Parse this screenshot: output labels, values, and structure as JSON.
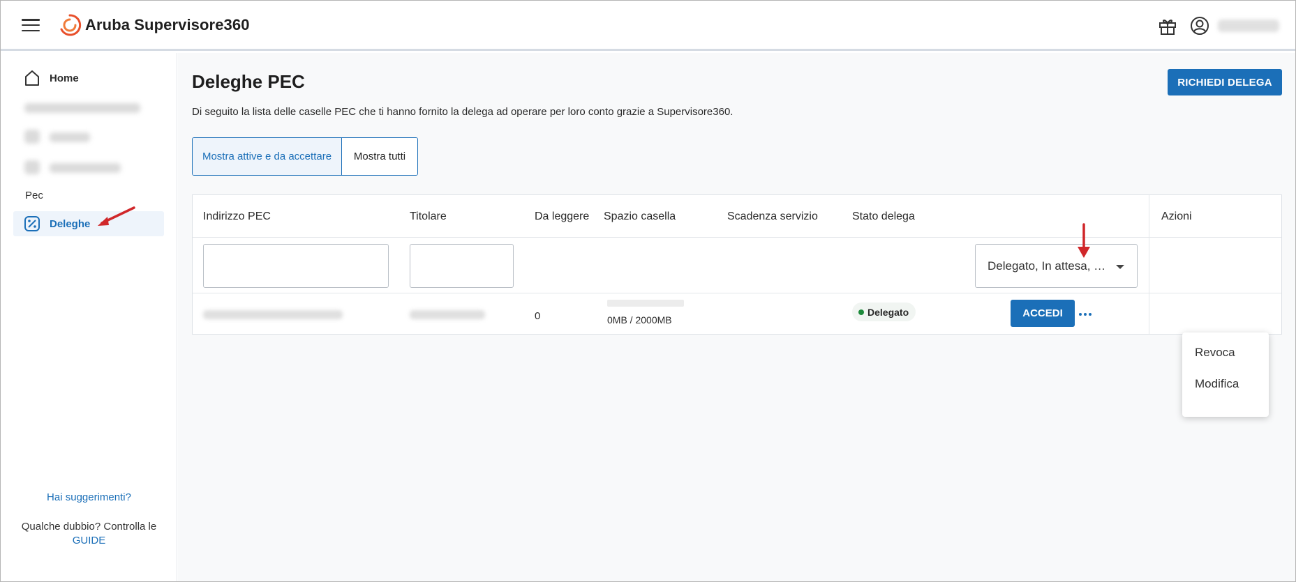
{
  "app": {
    "title": "Aruba Supervisore360"
  },
  "sidebar": {
    "items": [
      {
        "label": "Home",
        "icon": "home-icon"
      },
      {
        "label": "Deleghe",
        "icon": "deleghe-icon",
        "active": true
      }
    ],
    "section_label": "Pec",
    "help_link": "Hai suggerimenti?",
    "help_text_prefix": "Qualche dubbio? Controlla le",
    "help_guide_link": "GUIDE"
  },
  "main": {
    "title": "Deleghe PEC",
    "description": "Di seguito la lista delle caselle PEC che ti hanno fornito la delega ad operare per loro conto grazie a Supervisore360.",
    "primary_button": "RICHIEDI DELEGA",
    "toggle": {
      "active": "Mostra attive e da accettare",
      "inactive": "Mostra tutti"
    },
    "table": {
      "columns": [
        "Indirizzo PEC",
        "Titolare",
        "Da leggere",
        "Spazio casella",
        "Scadenza servizio",
        "Stato delega",
        "Azioni"
      ],
      "status_filter": "Delegato, In attesa, …",
      "rows": [
        {
          "da_leggere": "0",
          "spazio": "0MB / 2000MB",
          "spazio_used_fraction": 0,
          "stato": "Delegato",
          "action": "ACCEDI"
        }
      ]
    }
  },
  "menu": {
    "items": [
      "Revoca",
      "Modifica"
    ]
  },
  "colors": {
    "accent": "#1b6fb8",
    "status_ok": "#1d8a3b",
    "annotation": "#d0272a"
  }
}
